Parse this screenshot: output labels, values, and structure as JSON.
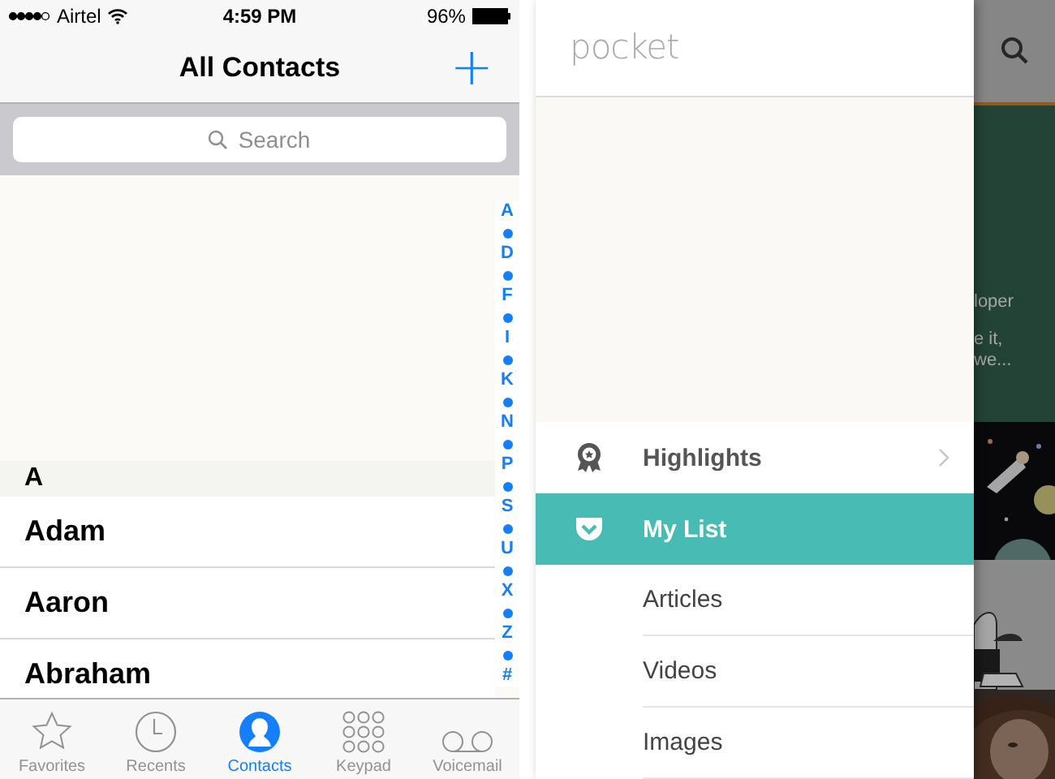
{
  "contacts": {
    "status_bar": {
      "carrier": "Airtel",
      "time": "4:59 PM",
      "battery": "96%"
    },
    "nav": {
      "title": "All Contacts",
      "add": "+"
    },
    "search": {
      "placeholder": "Search"
    },
    "section": "A",
    "rows": [
      "Adam",
      "Aaron",
      "Abraham"
    ],
    "index": [
      "A",
      "D",
      "F",
      "I",
      "K",
      "N",
      "P",
      "S",
      "U",
      "X",
      "Z",
      "#"
    ],
    "tabs": [
      {
        "label": "Favorites",
        "kind": "star",
        "selected": false
      },
      {
        "label": "Recents",
        "kind": "clock",
        "selected": false
      },
      {
        "label": "Contacts",
        "kind": "person",
        "selected": true
      },
      {
        "label": "Keypad",
        "kind": "keypad",
        "selected": false
      },
      {
        "label": "Voicemail",
        "kind": "voicemail",
        "selected": false
      }
    ]
  },
  "pocket": {
    "logo": "pocket",
    "menu": [
      {
        "label": "Highlights",
        "kind": "award",
        "selected": false
      },
      {
        "label": "My List",
        "kind": "pocket",
        "selected": true
      },
      {
        "label": "Articles",
        "kind": "filter",
        "selected": false
      },
      {
        "label": "Videos",
        "kind": "filter",
        "selected": false
      },
      {
        "label": "Images",
        "kind": "filter",
        "selected": false
      }
    ],
    "card_text": [
      "loper",
      "e it,",
      "we..."
    ]
  }
}
